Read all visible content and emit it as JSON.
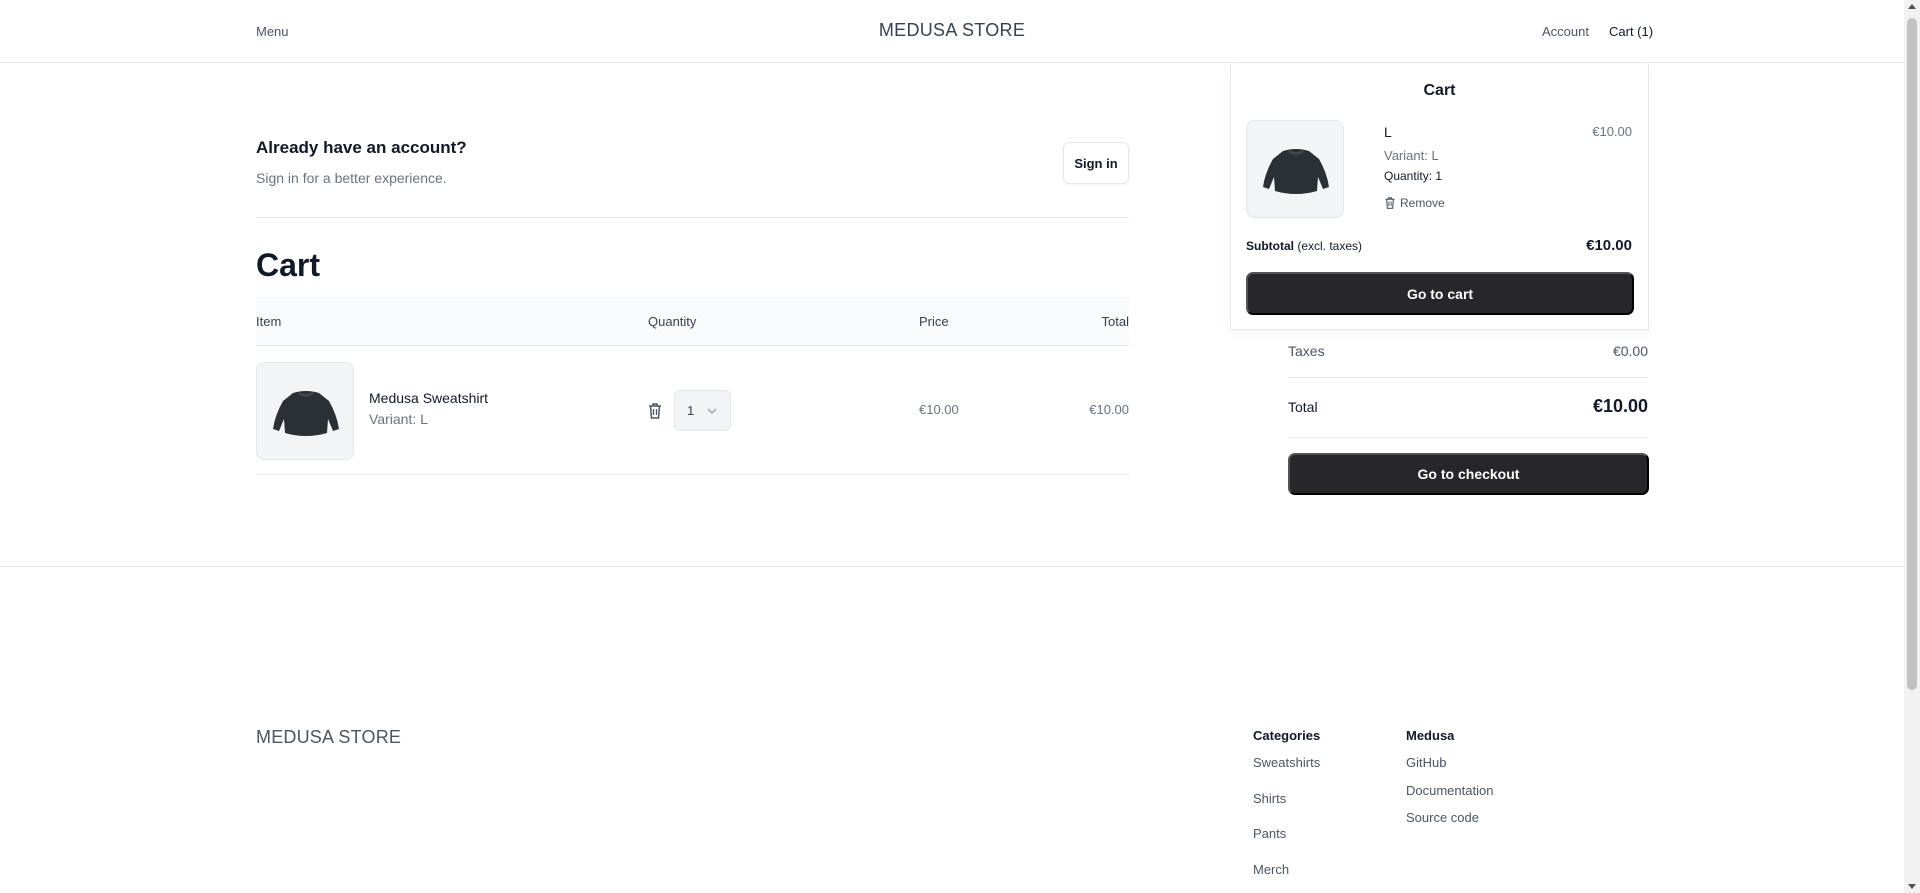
{
  "header": {
    "menu_label": "Menu",
    "brand": "MEDUSA STORE",
    "account_label": "Account",
    "cart_label": "Cart (1)"
  },
  "signin": {
    "title": "Already have an account?",
    "subtitle": "Sign in for a better experience.",
    "button_label": "Sign in"
  },
  "cart": {
    "heading": "Cart",
    "columns": [
      "Item",
      "Quantity",
      "Price",
      "Total"
    ],
    "items": [
      {
        "name": "Medusa Sweatshirt",
        "variant": "Variant: L",
        "quantity": "1",
        "price": "€10.00",
        "total": "€10.00",
        "thumbnail_icon": "sweatshirt-image"
      }
    ]
  },
  "summary": {
    "taxes_label": "Taxes",
    "taxes_value": "€0.00",
    "total_label": "Total",
    "total_value": "€10.00",
    "checkout_label": "Go to checkout"
  },
  "dropdown": {
    "title": "Cart",
    "item_name": "L",
    "item_variant": "Variant: L",
    "item_quantity": "Quantity: 1",
    "item_price": "€10.00",
    "remove_label": "Remove",
    "subtotal_label": "Subtotal",
    "subtotal_note": "(excl. taxes)",
    "subtotal_value": "€10.00",
    "go_to_cart_label": "Go to cart"
  },
  "footer": {
    "brand": "MEDUSA STORE",
    "categories": {
      "heading": "Categories",
      "links": [
        "Sweatshirts",
        "Shirts",
        "Pants",
        "Merch"
      ]
    },
    "medusa": {
      "heading": "Medusa",
      "links": [
        "GitHub",
        "Documentation",
        "Source code"
      ]
    }
  },
  "colors": {
    "primary_button": "#27272a",
    "border": "#e5e7eb",
    "muted_text": "#6b7280",
    "table_header_bg": "#f9fafb"
  }
}
